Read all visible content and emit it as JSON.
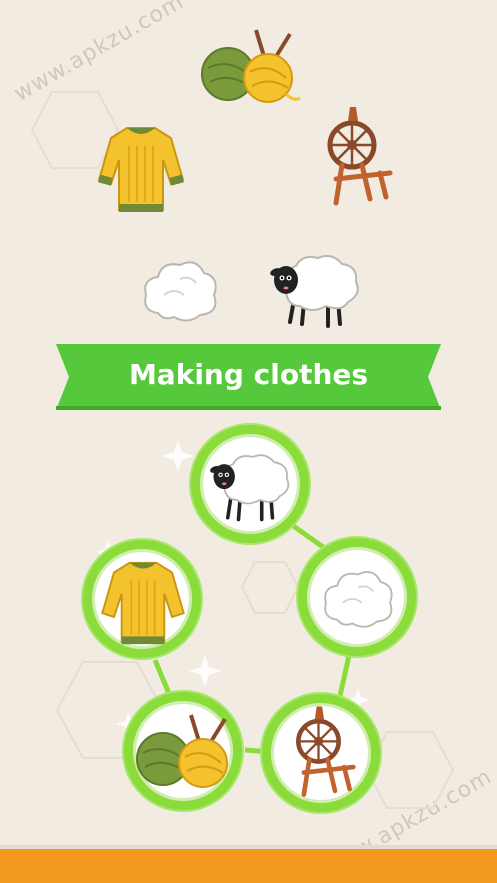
{
  "banner": {
    "title": "Making clothes",
    "color": "#55c93b"
  },
  "watermarks": [
    "www.apkzu.com",
    "www.apkzu.com"
  ],
  "top_items": [
    "yarn-icon",
    "spinning-wheel-icon",
    "sweater-icon",
    "cotton-icon",
    "sheep-icon"
  ],
  "chain_nodes": [
    "sheep-icon",
    "cotton-icon",
    "spinning-wheel-icon",
    "yarn-icon",
    "sweater-icon"
  ],
  "colors": {
    "background": "#f2ebe1",
    "ring": "#8bdc3a",
    "bottom_bar": "#f39a1e"
  }
}
